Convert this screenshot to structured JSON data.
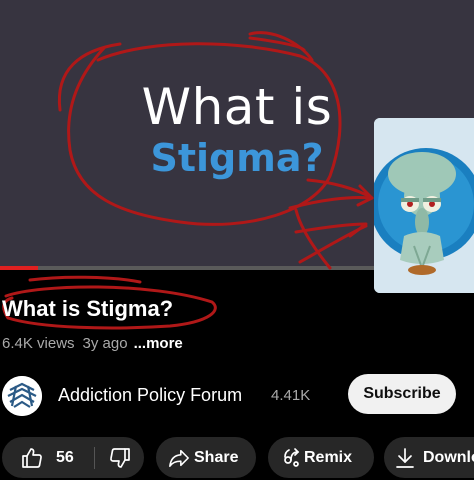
{
  "video": {
    "title_line1": "What is",
    "title_line2": "Stigma?",
    "progress_fraction": 0.08
  },
  "title": "What is Stigma?",
  "meta": {
    "views": "6.4K views",
    "age": "3y ago",
    "more": "...more"
  },
  "channel": {
    "name": "Addiction Policy Forum",
    "subscribers": "4.41K",
    "subscribe_label": "Subscribe"
  },
  "actions": {
    "likes": "56",
    "share": "Share",
    "remix": "Remix",
    "download": "Downlo"
  },
  "icons": {
    "like": "thumbs-up-icon",
    "dislike": "thumbs-down-icon",
    "share": "share-arrow-icon",
    "remix": "remix-icon",
    "download": "download-icon"
  },
  "colors": {
    "stigma_blue": "#3c96da",
    "annotation_red": "#b01818",
    "subscribe_bg": "#f1f1f1"
  }
}
